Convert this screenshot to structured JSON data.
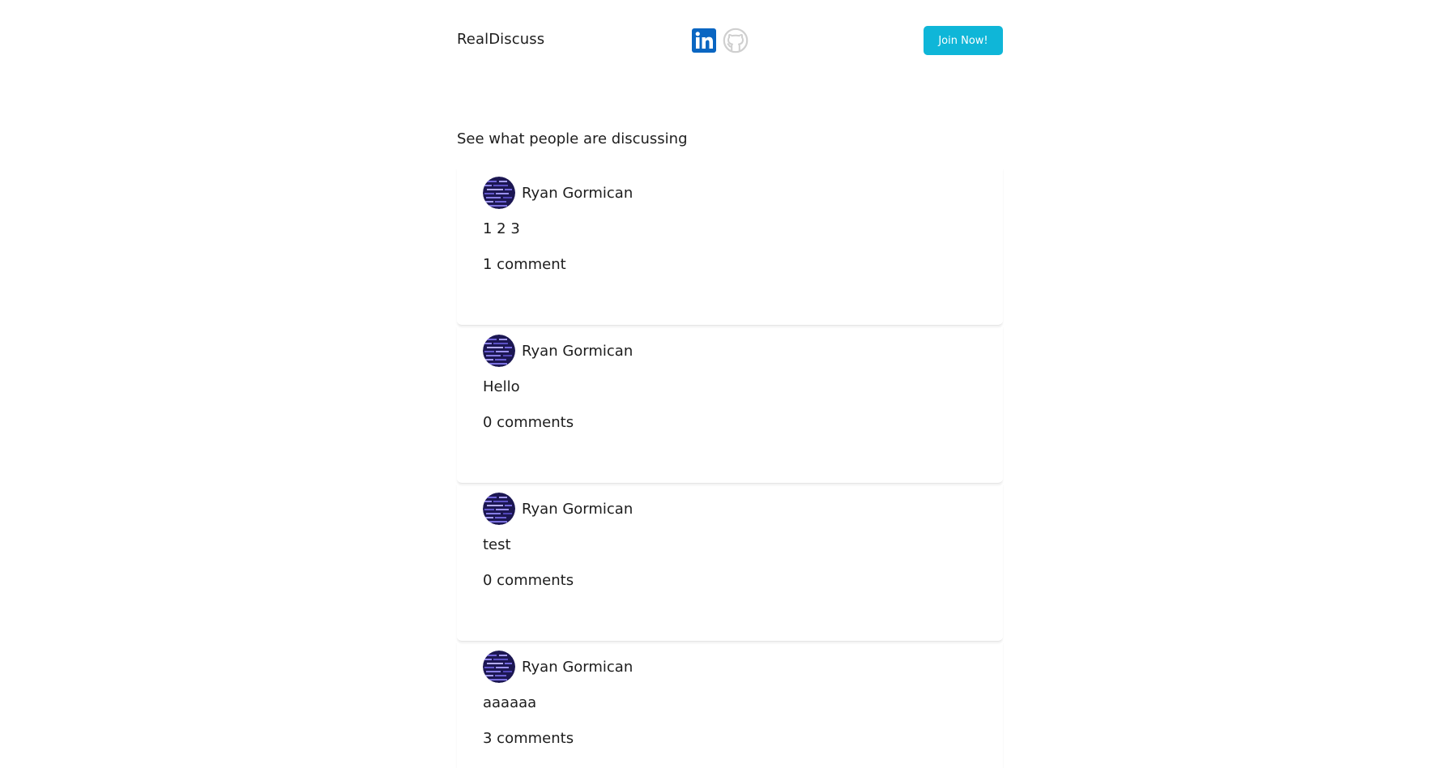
{
  "header": {
    "brand": "RealDiscuss",
    "join_label": "Join Now!",
    "accent_color": "#0fb6d8",
    "social_icons": [
      "linkedin-icon",
      "github-icon"
    ]
  },
  "main": {
    "title": "See what people are discussing",
    "posts": [
      {
        "author": "Ryan Gormican",
        "text": "1 2 3",
        "comments": "1 comment"
      },
      {
        "author": "Ryan Gormican",
        "text": "Hello",
        "comments": "0 comments"
      },
      {
        "author": "Ryan Gormican",
        "text": "test",
        "comments": "0 comments"
      },
      {
        "author": "Ryan Gormican",
        "text": "aaaaaa",
        "comments": "3 comments"
      }
    ]
  }
}
